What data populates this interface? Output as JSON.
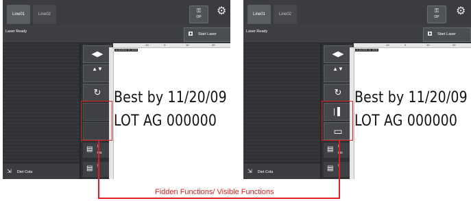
{
  "left_panel": {
    "tabs": [
      "Line01",
      "Line02"
    ],
    "op_button": {
      "icon": "key-icon",
      "label": "OP"
    },
    "gear_icon": "gear-icon",
    "status": "Laser Ready",
    "start_button": "Start Laser",
    "tools": {
      "move_horizontal": "◀▶",
      "move_vertical": "▲▼",
      "rotate": "↻"
    },
    "counter1": {
      "value": "0",
      "unit": "ms"
    },
    "counter2": {
      "value": "0"
    },
    "recipe": "Diet Cola",
    "ruler_ticks": [
      "-10",
      "0",
      "10",
      "20"
    ],
    "stamp": "11/20/2009 09:15/09",
    "preview_line1": "Best by 11/20/09",
    "preview_line2": "LOT AG 000000"
  },
  "right_panel": {
    "tabs": [
      "Line01",
      "Line02"
    ],
    "op_button": {
      "icon": "key-icon",
      "label": "OP"
    },
    "gear_icon": "gear-icon",
    "status": "Laser Ready",
    "start_button": "Start Laser",
    "tools": {
      "move_horizontal": "◀▶",
      "move_vertical": "▲▼",
      "rotate": "↻",
      "hidden1": "| ▌",
      "hidden2": "▭"
    },
    "counter1": {
      "value": "0",
      "unit": "ms"
    },
    "counter2": {
      "value": "0"
    },
    "recipe": "Diet Cola",
    "ruler_ticks": [
      "-10",
      "0",
      "10",
      "20"
    ],
    "stamp": "11/20/2009 09:15/09",
    "preview_line1": "Best by 11/20/09",
    "preview_line2": "LOT AG 000000"
  },
  "caption": "Fidden Functions/ Visible Functions",
  "colors": {
    "accent_red": "#e02020",
    "panel_bg": "#2f3135"
  }
}
